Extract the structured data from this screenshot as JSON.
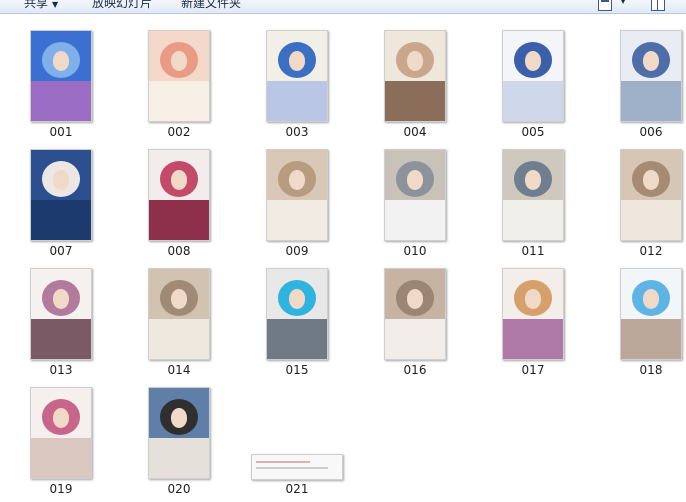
{
  "toolbar": {
    "share_label": "共享",
    "slideshow_label": "放映幻灯片",
    "new_folder_label": "新建文件夹"
  },
  "icons": {
    "dropdown": "chevron-down-icon",
    "view": "view-options-icon",
    "preview": "preview-pane-icon"
  },
  "files": [
    {
      "name": "001",
      "colors": [
        "#3b6fd1",
        "#7fb0ea",
        "#9b6cc4"
      ]
    },
    {
      "name": "002",
      "colors": [
        "#f4d8c9",
        "#ea9b86",
        "#f7efe6"
      ]
    },
    {
      "name": "003",
      "colors": [
        "#f2efe7",
        "#3a6fc4",
        "#b9c6e6"
      ]
    },
    {
      "name": "004",
      "colors": [
        "#efe6dc",
        "#c9a78c",
        "#8b6e5a"
      ]
    },
    {
      "name": "005",
      "colors": [
        "#f4f5f8",
        "#3b5fa8",
        "#cfd7ea"
      ]
    },
    {
      "name": "006",
      "colors": [
        "#e9edf3",
        "#4d6ea8",
        "#9fb0c9"
      ]
    },
    {
      "name": "007",
      "colors": [
        "#2b4f8f",
        "#ece7e2",
        "#1d3a6e"
      ]
    },
    {
      "name": "008",
      "colors": [
        "#f2ecec",
        "#c44a6a",
        "#8e2f4c"
      ]
    },
    {
      "name": "009",
      "colors": [
        "#d9c8b5",
        "#b89c80",
        "#f1ebe4"
      ]
    },
    {
      "name": "010",
      "colors": [
        "#c9c2b8",
        "#8c939d",
        "#f2f2f2"
      ]
    },
    {
      "name": "011",
      "colors": [
        "#cfc8bd",
        "#6f7f8f",
        "#f1efea"
      ]
    },
    {
      "name": "012",
      "colors": [
        "#d8c6b4",
        "#a68b74",
        "#efe7dd"
      ]
    },
    {
      "name": "013",
      "colors": [
        "#f5f1ee",
        "#b27a9c",
        "#7a5a64"
      ]
    },
    {
      "name": "014",
      "colors": [
        "#d2c2b0",
        "#9f8a75",
        "#efe8df"
      ]
    },
    {
      "name": "015",
      "colors": [
        "#e8e8e8",
        "#2fb4e0",
        "#6f7a84"
      ]
    },
    {
      "name": "016",
      "colors": [
        "#c7b3a2",
        "#9b8574",
        "#f2ede8"
      ]
    },
    {
      "name": "017",
      "colors": [
        "#f3eee9",
        "#d6a06a",
        "#b07aa8"
      ]
    },
    {
      "name": "018",
      "colors": [
        "#f3f6f9",
        "#5fb4e6",
        "#bca89a"
      ]
    },
    {
      "name": "019",
      "colors": [
        "#f5f0ee",
        "#c7668a",
        "#d9c7c0"
      ]
    },
    {
      "name": "020",
      "colors": [
        "#5f7fa8",
        "#2f2f2f",
        "#e6e0da"
      ]
    },
    {
      "name": "021",
      "colors": [
        "#f8f8f8",
        "#e0b0b0",
        "#cccccc"
      ]
    }
  ]
}
